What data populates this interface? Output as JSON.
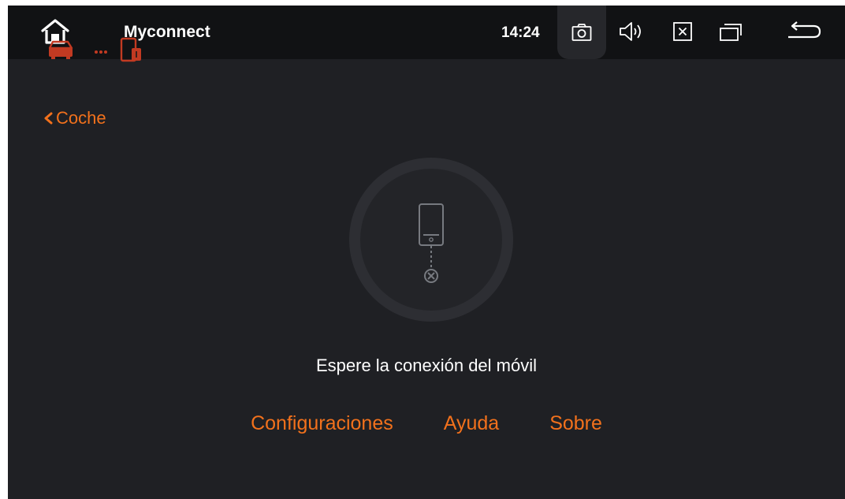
{
  "statusbar": {
    "app_title": "Myconnect",
    "time": "14:24",
    "icons": [
      "home-icon",
      "camera-icon",
      "volume-icon",
      "close-box-icon",
      "recent-apps-icon",
      "back-icon"
    ]
  },
  "nav": {
    "back_label": "Coche"
  },
  "main": {
    "status_icon": "phone-disconnected-icon",
    "status_text": "Espere la conexión del móvil"
  },
  "links": {
    "settings_label": "Configuraciones",
    "help_label": "Ayuda",
    "about_label": "Sobre"
  },
  "colors": {
    "accent": "#f2711c",
    "background": "#1f2024",
    "statusbar": "#111214"
  }
}
